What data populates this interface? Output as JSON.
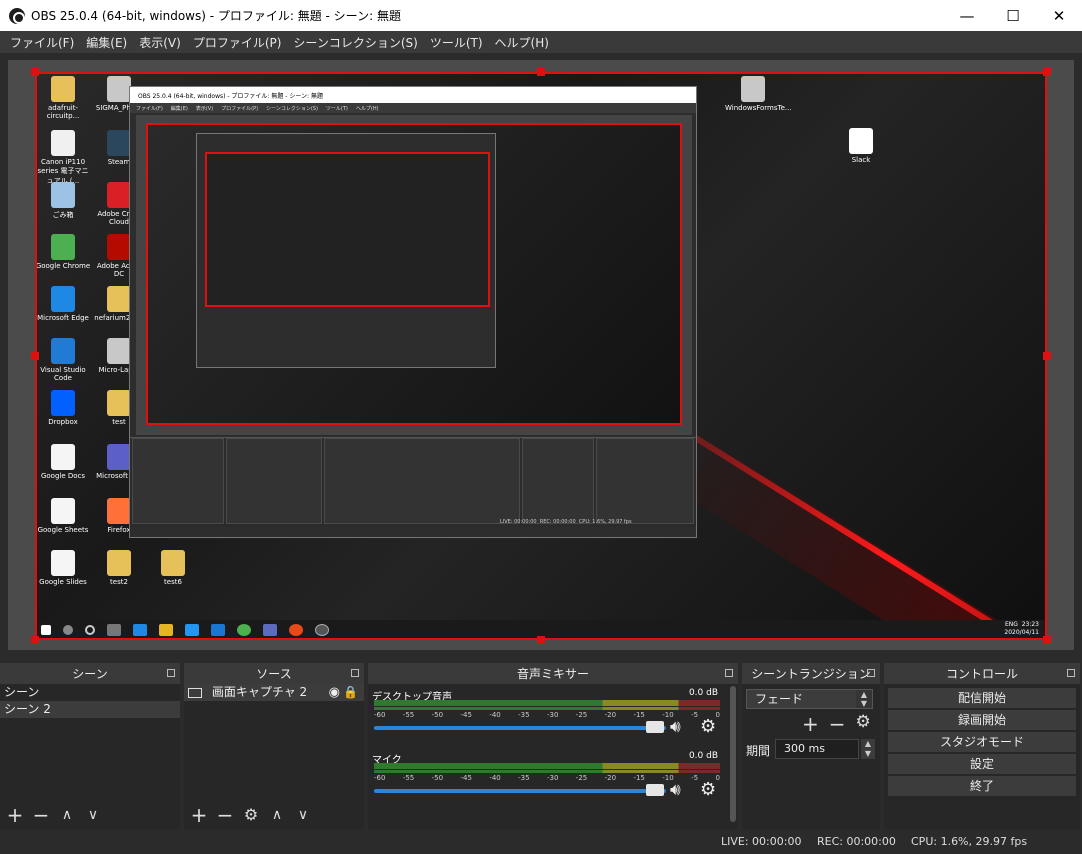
{
  "window": {
    "title": "OBS 25.0.4 (64-bit, windows) - プロファイル: 無題 - シーン: 無題",
    "minimize": "—",
    "maximize": "☐",
    "close": "✕"
  },
  "menu": [
    "ファイル(F)",
    "編集(E)",
    "表示(V)",
    "プロファイル(P)",
    "シーンコレクション(S)",
    "ツール(T)",
    "ヘルプ(H)"
  ],
  "desktop_icons": [
    {
      "label": "adafruit-circuitp...",
      "icon": "folder-icon"
    },
    {
      "label": "SIGMA_Photo",
      "icon": "app-icon"
    },
    {
      "label": "Canon iP110 series 電子マニュアル (...",
      "icon": "document-icon"
    },
    {
      "label": "Steam",
      "icon": "steam-icon"
    },
    {
      "label": "ごみ箱",
      "icon": "recycle-bin-icon"
    },
    {
      "label": "Adobe Creat Cloud",
      "icon": "adobe-cc-icon"
    },
    {
      "label": "Google Chrome",
      "icon": "chrome-icon"
    },
    {
      "label": "Adobe Acrob DC",
      "icon": "acrobat-icon"
    },
    {
      "label": "Microsoft Edge",
      "icon": "edge-icon"
    },
    {
      "label": "nefarium2018",
      "icon": "folder-icon"
    },
    {
      "label": "Visual Studio Code",
      "icon": "vscode-icon"
    },
    {
      "label": "Micro-Lap 9",
      "icon": "app-icon"
    },
    {
      "label": "Dropbox",
      "icon": "dropbox-icon"
    },
    {
      "label": "test",
      "icon": "folder-icon"
    },
    {
      "label": "Google Docs",
      "icon": "docs-icon"
    },
    {
      "label": "Microsoft Tea",
      "icon": "teams-icon"
    },
    {
      "label": "Google Sheets",
      "icon": "sheets-icon"
    },
    {
      "label": "Firefox",
      "icon": "firefox-icon"
    },
    {
      "label": "Google Slides",
      "icon": "slides-icon"
    },
    {
      "label": "test2",
      "icon": "folder-icon"
    },
    {
      "label": "test6",
      "icon": "folder-icon"
    },
    {
      "label": "WindowsFormsTe...",
      "icon": "app-icon"
    },
    {
      "label": "Slack",
      "icon": "slack-icon"
    }
  ],
  "taskbar_clock": {
    "time": "23:23",
    "date": "2020/04/11",
    "lang": "ENG"
  },
  "scenes": {
    "title": "シーン",
    "items": [
      "シーン",
      "シーン 2"
    ],
    "selected": 1
  },
  "sources": {
    "title": "ソース",
    "items": [
      {
        "name": "画面キャプチャ 2",
        "visible": true,
        "locked": true
      }
    ]
  },
  "mixer": {
    "title": "音声ミキサー",
    "channels": [
      {
        "name": "デスクトップ音声",
        "db": "0.0 dB",
        "volume": 1.0
      },
      {
        "name": "マイク",
        "db": "0.0 dB",
        "volume": 1.0
      }
    ],
    "ticks": [
      "-60",
      "-55",
      "-50",
      "-45",
      "-40",
      "-35",
      "-30",
      "-25",
      "-20",
      "-15",
      "-10",
      "-5",
      "0"
    ]
  },
  "transitions": {
    "title": "シーントランジション",
    "selected": "フェード",
    "duration_label": "期間",
    "duration": "300 ms"
  },
  "controls": {
    "title": "コントロール",
    "buttons": [
      "配信開始",
      "録画開始",
      "スタジオモード",
      "設定",
      "終了"
    ]
  },
  "status": {
    "live": "LIVE: 00:00:00",
    "rec": "REC: 00:00:00",
    "cpu": "CPU: 1.6%, 29.97 fps"
  },
  "nested_window": {
    "title": "OBS 25.0.4 (64-bit, windows) - プロファイル: 無題 - シーン: 無題"
  }
}
